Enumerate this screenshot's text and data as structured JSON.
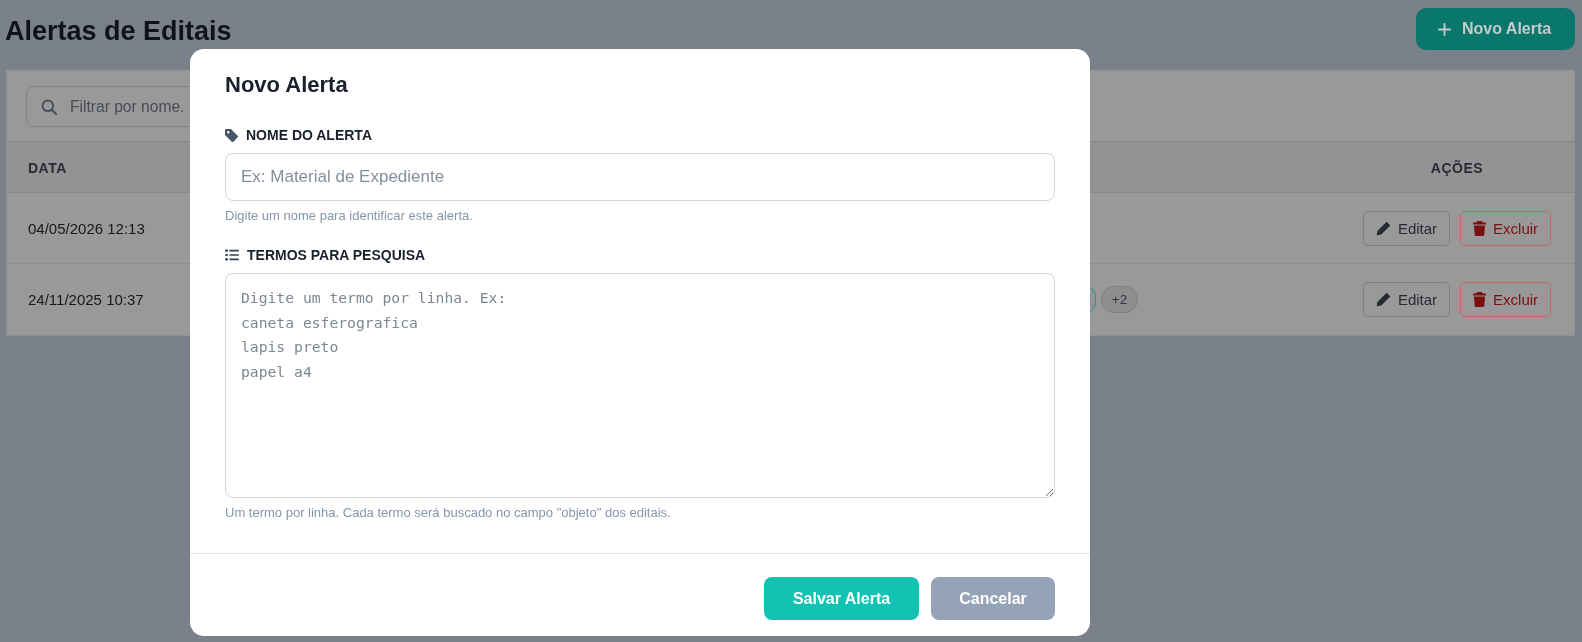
{
  "page": {
    "title": "Alertas de Editais",
    "new_button": {
      "label": "Novo Alerta"
    }
  },
  "filter": {
    "placeholder": "Filtrar por nome."
  },
  "table": {
    "columns": [
      {
        "kind": "date",
        "label": "DATA"
      },
      {
        "kind": "actions",
        "label": "AÇÕES"
      }
    ],
    "rows": [
      {
        "date": "04/05/2026 12:13",
        "tag_cut_off": false,
        "actions": [
          {
            "kind": "edit",
            "label": "Editar"
          },
          {
            "kind": "delete",
            "label": "Excluir"
          }
        ]
      },
      {
        "date": "24/11/2025 10:37",
        "tag_cut_off": true,
        "more": "+2",
        "actions": [
          {
            "kind": "edit",
            "label": "Editar"
          },
          {
            "kind": "delete",
            "label": "Excluir"
          }
        ]
      }
    ]
  },
  "modal": {
    "title": "Novo Alerta",
    "fields": [
      {
        "kind": "input",
        "label": "NOME DO ALERTA",
        "placeholder": "Ex: Material de Expediente",
        "help": "Digite um nome para identificar este alerta."
      },
      {
        "kind": "textarea",
        "label": "TERMOS PARA PESQUISA",
        "placeholder": "Digite um termo por linha. Ex:\ncaneta esferografica\nlapis preto\npapel a4",
        "help": "Um termo por linha. Cada termo será buscado no campo \"objeto\" dos editais."
      }
    ],
    "buttons": [
      {
        "kind": "primary",
        "label": "Salvar Alerta"
      },
      {
        "kind": "secondary",
        "label": "Cancelar"
      }
    ]
  }
}
